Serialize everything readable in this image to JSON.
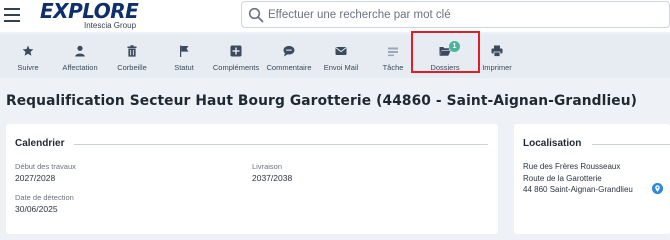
{
  "header": {
    "logo_text": "EXPLORE",
    "logo_subtext": "Intescia Group",
    "search_placeholder": "Effectuer une recherche par mot clé"
  },
  "toolbar": {
    "items": [
      {
        "label": "Suivre",
        "icon": "star-icon"
      },
      {
        "label": "Affectation",
        "icon": "user-icon"
      },
      {
        "label": "Corbeille",
        "icon": "trash-icon"
      },
      {
        "label": "Statut",
        "icon": "flag-icon"
      },
      {
        "label": "Compléments",
        "icon": "plus-square-icon"
      },
      {
        "label": "Commentaire",
        "icon": "comment-icon"
      },
      {
        "label": "Envoi Mail",
        "icon": "envelope-icon"
      },
      {
        "label": "Tâche",
        "icon": "task-icon"
      },
      {
        "label": "Dossiers",
        "icon": "folder-open-icon",
        "badge": "1"
      },
      {
        "label": "Imprimer",
        "icon": "printer-icon"
      }
    ],
    "highlight_color": "#e11d2a",
    "badge_color": "#4ab59b"
  },
  "page": {
    "title": "Requalification Secteur Haut Bourg Garotterie (44860 - Saint-Aignan-Grandlieu)"
  },
  "calendar": {
    "heading": "Calendrier",
    "fields": [
      {
        "label": "Début des travaux",
        "value": "2027/2028"
      },
      {
        "label": "Livraison",
        "value": "2037/2038"
      },
      {
        "label": "Date de détection",
        "value": "30/06/2025"
      }
    ]
  },
  "location": {
    "heading": "Localisation",
    "lines": [
      "Rue des Frères Rousseaux",
      "Route de la Garotterie",
      "44 860 Saint-Aignan-Grandlieu"
    ],
    "pin_icon": "map-pin-icon"
  }
}
